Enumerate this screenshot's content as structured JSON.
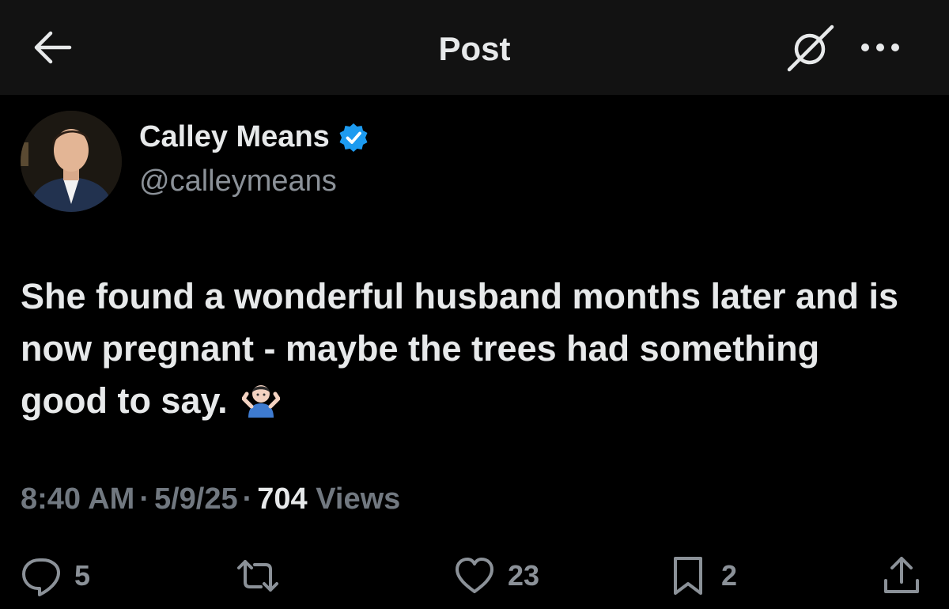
{
  "header": {
    "title": "Post",
    "back_icon": "arrow-left-icon",
    "grok_icon": "grok-icon",
    "more_icon": "more-dots-icon"
  },
  "author": {
    "name": "Calley Means",
    "handle": "@calleymeans",
    "verified": true,
    "verified_color": "#1d9bf0"
  },
  "post": {
    "text": "She found a wonderful husband months later and is now pregnant - maybe the trees had something good to say.",
    "emoji": "🤷🏻‍♂️",
    "time": "8:40 AM",
    "date": "5/9/25",
    "views_count": "704",
    "views_label": "Views",
    "separator": "·"
  },
  "actions": {
    "replies": "5",
    "reposts": "",
    "likes": "23",
    "bookmarks": "2"
  },
  "colors": {
    "background": "#000000",
    "header_bg": "#121212",
    "text": "#e7e9ea",
    "muted": "#8b9198"
  }
}
